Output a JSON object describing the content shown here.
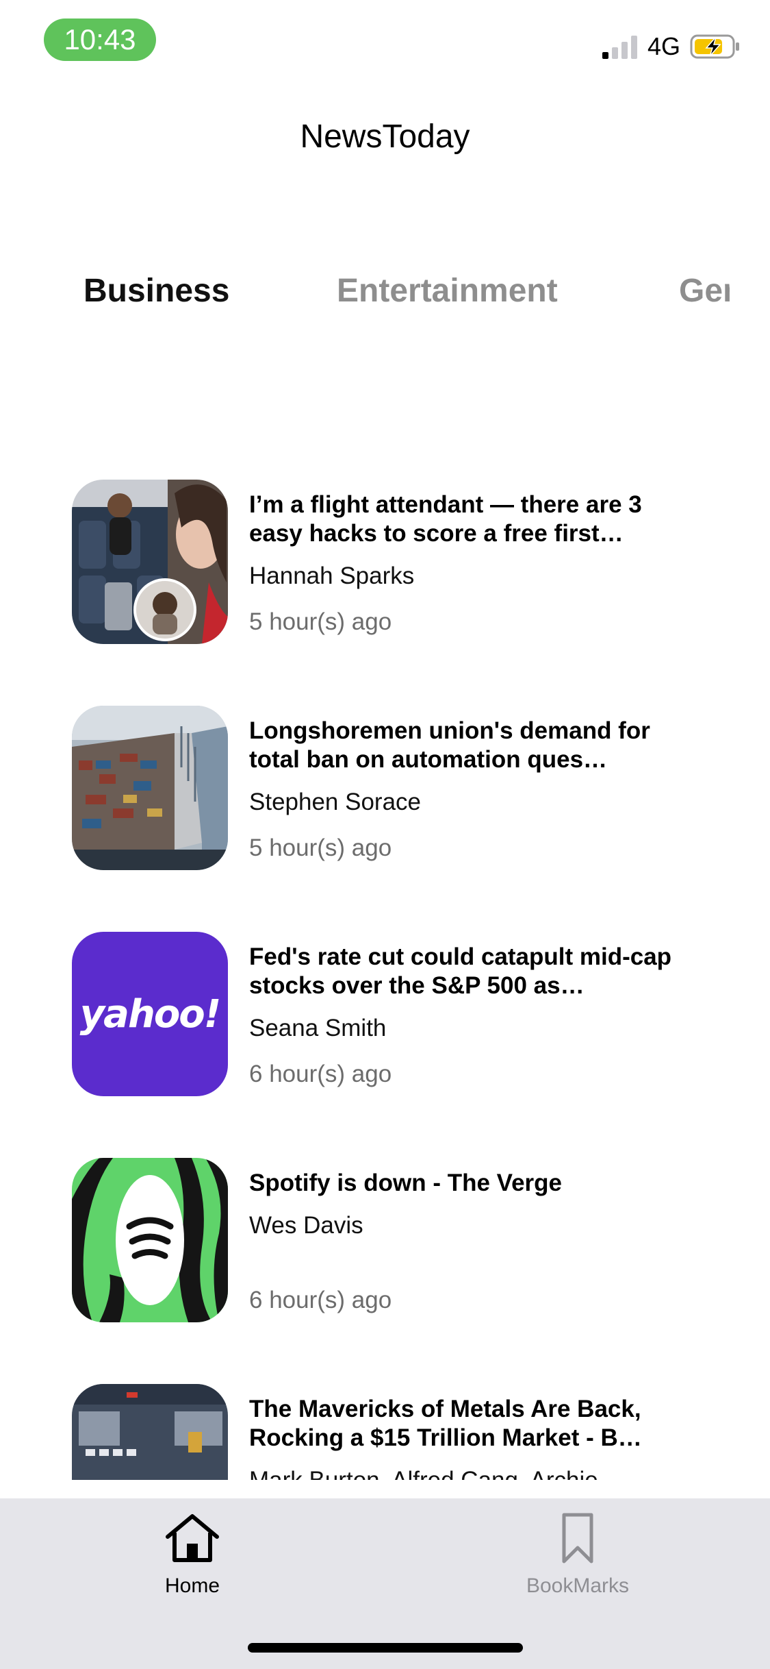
{
  "status_bar": {
    "time": "10:43",
    "network": "4G",
    "time_pill_color": "#5fc35b",
    "battery_color": "#f5c400"
  },
  "app": {
    "title": "NewsToday"
  },
  "categories": [
    {
      "label": "Business",
      "active": true
    },
    {
      "label": "Entertainment",
      "active": false
    },
    {
      "label": "General",
      "active": false
    }
  ],
  "articles": [
    {
      "title": "I’m a flight attendant — there are 3 easy hacks to score a free first…",
      "author": "Hannah Sparks",
      "time": "5 hour(s) ago",
      "thumb": "cabin-photo"
    },
    {
      "title": "Longshoremen union's demand for total ban on automation ques…",
      "author": "Stephen Sorace",
      "time": "5 hour(s) ago",
      "thumb": "port-photo"
    },
    {
      "title": "Fed's rate cut could catapult mid-cap stocks over the S&P 500 as…",
      "author": "Seana Smith",
      "time": "6 hour(s) ago",
      "thumb": "yahoo-logo",
      "thumb_text": "yahoo!",
      "thumb_color": "#5b2ccd"
    },
    {
      "title": "Spotify is down - The Verge",
      "author": "Wes Davis",
      "time": "6 hour(s) ago",
      "thumb": "spotify-art",
      "thumb_color": "#5fd36a"
    },
    {
      "title": "The Mavericks of Metals Are Back, Rocking a $15 Trillion Market - B…",
      "author": "Mark Burton, Alfred Cang, Archie…",
      "time": "",
      "thumb": "warehouse-photo"
    }
  ],
  "tabbar": {
    "home_label": "Home",
    "bookmarks_label": "BookMarks"
  }
}
